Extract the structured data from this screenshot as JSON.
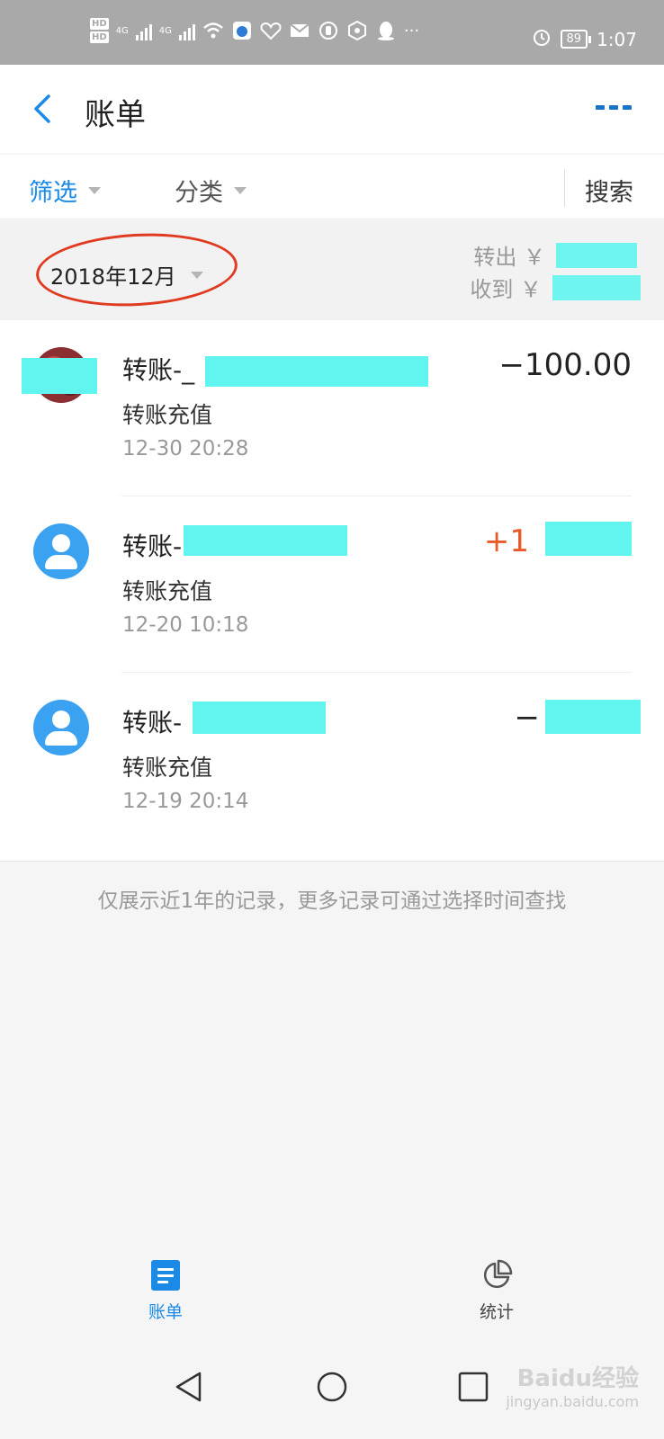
{
  "status_bar": {
    "hd_top": "HD",
    "hd_bottom": "HD",
    "net1": "4G",
    "net2": "4G",
    "more": "···",
    "battery": "89",
    "time": "1:07"
  },
  "header": {
    "title": "账单"
  },
  "filters": {
    "filter_label": "筛选",
    "category_label": "分类",
    "search_label": "搜索"
  },
  "month_bar": {
    "month": "2018年12月",
    "out_label": "转出 ￥",
    "in_label": "收到 ￥"
  },
  "transactions": [
    {
      "title": "转账-_",
      "subtitle": "转账充值",
      "time": "12-30  20:28",
      "amount": "−100.00",
      "type": "out"
    },
    {
      "title": "转账-",
      "subtitle": "转账充值",
      "time": "12-20  10:18",
      "amount": "+1",
      "type": "in"
    },
    {
      "title": "转账-",
      "subtitle": "转账充值",
      "time": "12-19  20:14",
      "amount": "−",
      "type": "out"
    }
  ],
  "note": "仅展示近1年的记录，更多记录可通过选择时间查找",
  "tabs": [
    {
      "label": "账单",
      "icon": "bill-icon",
      "active": true
    },
    {
      "label": "统计",
      "icon": "pie-chart-icon",
      "active": false
    }
  ],
  "watermark": {
    "brand": "Baidu经验",
    "url": "jingyan.baidu.com"
  },
  "colors": {
    "accent": "#1a8ae6",
    "income": "#e85a29",
    "annotation": "#e03a20",
    "mask": "#62f5ef"
  }
}
